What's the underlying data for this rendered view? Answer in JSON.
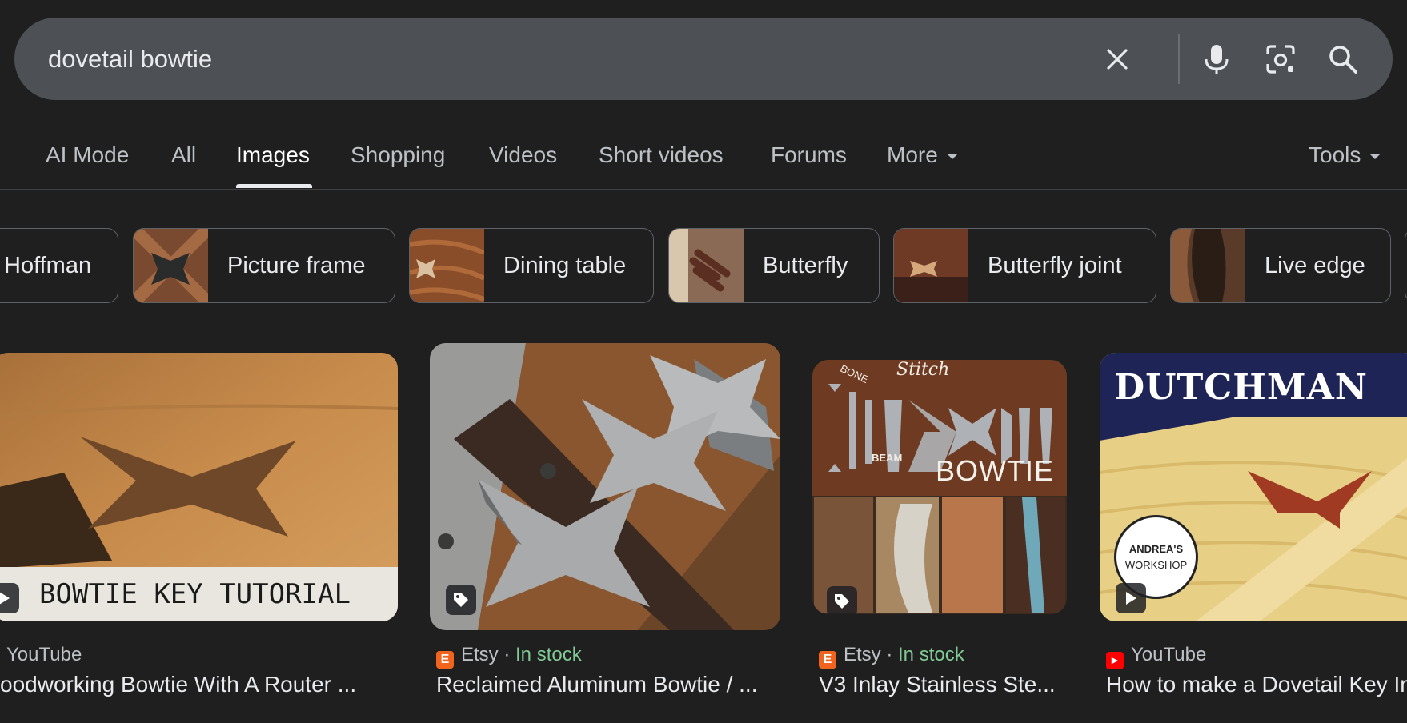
{
  "search": {
    "query": "dovetail bowtie"
  },
  "icons": {
    "clear": "close-icon",
    "voice": "microphone-icon",
    "lens": "camera-lens-icon",
    "search": "search-icon"
  },
  "tabs": {
    "ai_mode": "AI Mode",
    "all": "All",
    "images": "Images",
    "shopping": "Shopping",
    "videos": "Videos",
    "short_videos": "Short videos",
    "forums": "Forums",
    "more": "More",
    "tools": "Tools"
  },
  "chips": [
    {
      "label": "Hoffman"
    },
    {
      "label": "Picture frame"
    },
    {
      "label": "Dining table"
    },
    {
      "label": "Butterfly"
    },
    {
      "label": "Butterfly joint"
    },
    {
      "label": "Live edge"
    }
  ],
  "results": [
    {
      "source": "YouTube",
      "title": "oodworking Bowtie With A Router ...",
      "overlay_text": "BOWTIE KEY TUTORIAL",
      "badge": "play-icon"
    },
    {
      "source": "Etsy",
      "favicon": "E",
      "separator": " · ",
      "stock": "In stock",
      "title": "Reclaimed Aluminum Bowtie / ...",
      "badge": "price-tag-icon"
    },
    {
      "source": "Etsy",
      "favicon": "E",
      "separator": " · ",
      "stock": "In stock",
      "title": "V3 Inlay Stainless Ste...",
      "overlay_stitch": "Stitch",
      "overlay_bone": "BONE",
      "overlay_beam": "BEAM",
      "overlay_bowtie": "BOWTIE",
      "badge": "price-tag-icon"
    },
    {
      "source": "YouTube",
      "title": "How to make a Dovetail Key In",
      "overlay_heading": "DUTCHMAN",
      "overlay_logo_line1": "ANDREA'S",
      "overlay_logo_line2": "WORKSHOP",
      "badge": "play-icon"
    }
  ],
  "colors": {
    "background": "#1f1f1f",
    "searchbar": "#4d5156",
    "instock": "#81c995",
    "etsy": "#f1641e",
    "youtube": "#ff0000"
  }
}
